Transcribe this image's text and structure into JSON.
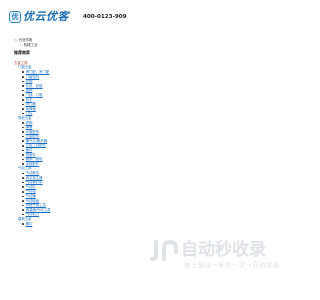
{
  "header": {
    "logo_mark": "优",
    "logo_text": "优云优客",
    "phone": "400-0123-909"
  },
  "breadcrumb": {
    "level1": "行业市场",
    "level2": "机械工业"
  },
  "recommend_title": "推荐商家",
  "top_category": {
    "label": "五金工具",
    "groups": [
      {
        "label": "门窗五金",
        "items": [
          "滑门配、吊门配",
          "门窗密封",
          "铰链",
          "合页、铰链",
          "插销",
          "门锁、门吸",
          "拉手",
          "闭门器",
          "地弹簧",
          "门控"
        ]
      },
      {
        "label": "其他五金",
        "items": [
          "滤网",
          "弹簧",
          "水管配件",
          "五金配件",
          "暖气片/散热器",
          "五金工具配件",
          "管件",
          "紧固件",
          "链条、链轮",
          "连接配件"
        ]
      },
      {
        "label": "气动工具",
        "items": [
          "气动扳手",
          "真空发生器",
          "气动铆钉机",
          "气动钉",
          "气动钳",
          "气动锤",
          "气动吸盘",
          "其他气动工具",
          "调温器/气动工具",
          "气动剪刀"
        ]
      },
      {
        "label": "建筑五金",
        "items": [
          "螺钉"
        ]
      }
    ]
  },
  "watermark": {
    "title": "自动秒收录",
    "subtitle": "做上链接→来访一次→自动收录"
  },
  "colors": {
    "link": "#1c6fc7",
    "category_red": "#b23a2a",
    "watermark_gray": "#dfe3e8",
    "logo_blue": "#1f6fb2"
  }
}
